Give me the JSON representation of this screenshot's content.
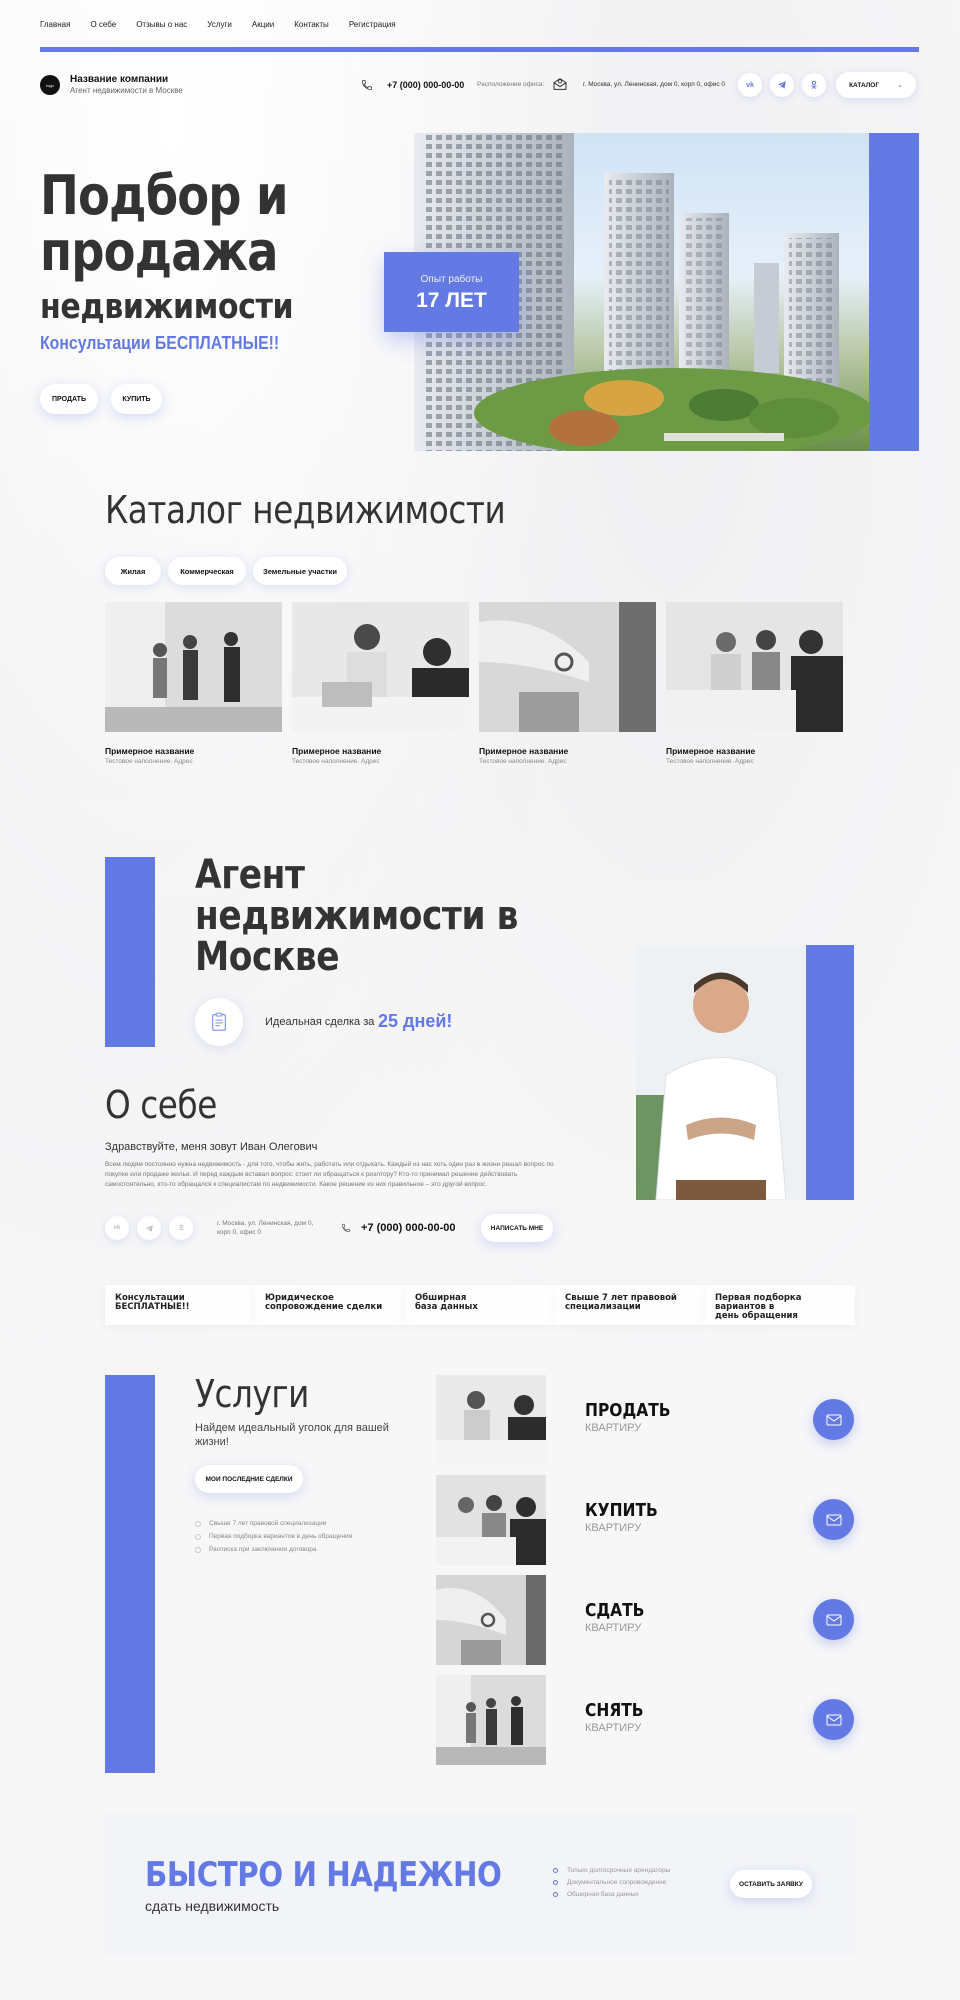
{
  "nav": {
    "items": [
      "Главная",
      "О себе",
      "Отзывы о нас",
      "Услуги",
      "Акции",
      "Контакты",
      "Регистрация"
    ]
  },
  "header": {
    "logo_text": "logo",
    "company_name": "Название компании",
    "company_sub": "Агент недвижимости в Москве",
    "phone": "+7 (000) 000-00-00",
    "location_label": "Расположение офиса:",
    "address": "г. Москва, ул. Ленинская, дом 0, корп 0, офис 0",
    "social_icons": [
      "vk-icon",
      "telegram-icon",
      "odnoklassniki-icon"
    ],
    "catalog_label": "КАТАЛОГ"
  },
  "hero": {
    "title_line1": "Подбор и",
    "title_line2": "продажа",
    "title_line3": "недвижимости",
    "consult": "Консультации БЕСПЛАТНЫЕ!!",
    "sell_label": "ПРОДАТЬ",
    "buy_label": "КУПИТЬ",
    "exp_label": "Опыт работы",
    "exp_value": "17 ЛЕТ"
  },
  "catalog": {
    "title": "Каталог недвижимости",
    "tabs": [
      "Жилая",
      "Коммерческая",
      "Земельные участки"
    ],
    "cards": [
      {
        "title": "Примерное название",
        "sub": "Тестовое наполнение. Адрес"
      },
      {
        "title": "Примерное название",
        "sub": "Тестовое наполнение. Адрес"
      },
      {
        "title": "Примерное название",
        "sub": "Тестовое наполнение. Адрес"
      },
      {
        "title": "Примерное название",
        "sub": "Тестовое наполнение. Адрес"
      }
    ]
  },
  "agent": {
    "title_line1": "Агент",
    "title_line2": "недвижимости в",
    "title_line3": "Москве",
    "deal_text": "Идеальная сделка за",
    "deal_days": "25 дней!",
    "about_title": "О себе",
    "greeting": "Здравствуйте, меня зовут Иван Олегович",
    "about_text": "Всем людям постоянно нужна недвижимость - для того, чтобы жить, работать или отдыхать. Каждый из нас хоть один раз в жизни решал вопрос по покупке или продаже жилья. И перед каждым вставал вопрос: стоит ли обращаться к риэлтору? Кто-то принимал решение действовать самостоятельно, кто-то обращался к специалистам по недвижимости. Какое решение из них правильное – это другой вопрос.",
    "address_line1": "г. Москва, ул. Ленинская, дом 0,",
    "address_line2": "корп 0, офис 0",
    "phone": "+7 (000) 000-00-00",
    "write_label": "НАПИСАТЬ МНЕ"
  },
  "features": [
    {
      "line1": "Консультации",
      "line2": "БЕСПЛАТНЫЕ!!"
    },
    {
      "line1": "Юридическое",
      "line2": "сопровождение сделки"
    },
    {
      "line1": "Обширная",
      "line2": "база данных"
    },
    {
      "line1": "Свыше 7 лет правовой",
      "line2": "специализации"
    },
    {
      "line1": "Первая подборка вариантов в",
      "line2": "день обращения"
    }
  ],
  "services": {
    "title": "Услуги",
    "subtitle": "Найдем идеальный уголок для вашей жизни!",
    "deals_label": "МОИ ПОСЛЕДНИЕ СДЕЛКИ",
    "bullets": [
      "Свыше 7 лет правовой специализации",
      "Первая подборка вариантов в день обращения",
      "Расписка при заключении договора"
    ],
    "items": [
      {
        "title": "ПРОДАТЬ",
        "sub": "КВАРТИРУ"
      },
      {
        "title": "КУПИТЬ",
        "sub": "КВАРТИРУ"
      },
      {
        "title": "СДАТЬ",
        "sub": "КВАРТИРУ"
      },
      {
        "title": "СНЯТЬ",
        "sub": "КВАРТИРУ"
      }
    ]
  },
  "promo": {
    "title": "БЫСТРО И НАДЕЖНО",
    "subtitle": "сдать недвижимость",
    "bullets": [
      "Только долгосрочные арендаторы",
      "Документальное сопровождение",
      "Обширная база данных"
    ],
    "cta_label": "ОСТАВИТЬ ЗАЯВКУ"
  },
  "colors": {
    "accent": "#6379e3",
    "text": "#2d2d2d"
  }
}
